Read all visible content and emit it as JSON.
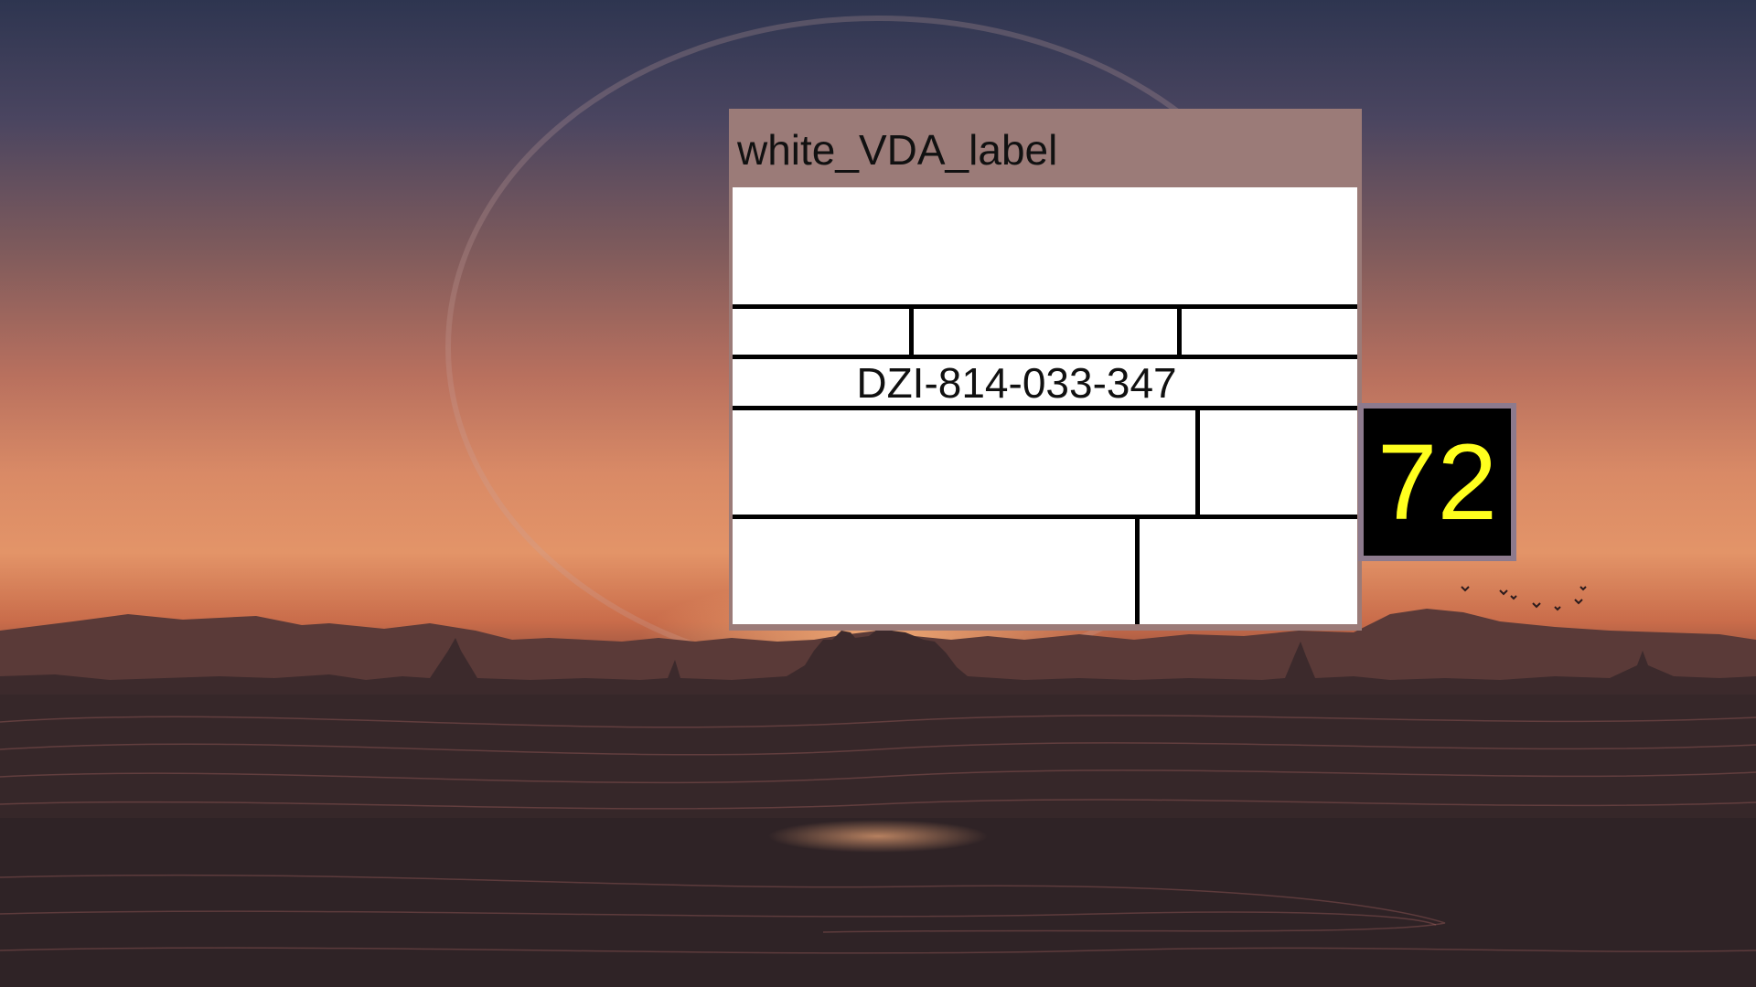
{
  "window": {
    "title": "white_VDA_label",
    "title_bar_color": "#9b7b78"
  },
  "label": {
    "tracking_number": "DZI-814-033-347",
    "background_color": "#ffffff"
  },
  "badge": {
    "value": "72",
    "text_color": "#ffff1e",
    "background_color": "#000000"
  }
}
